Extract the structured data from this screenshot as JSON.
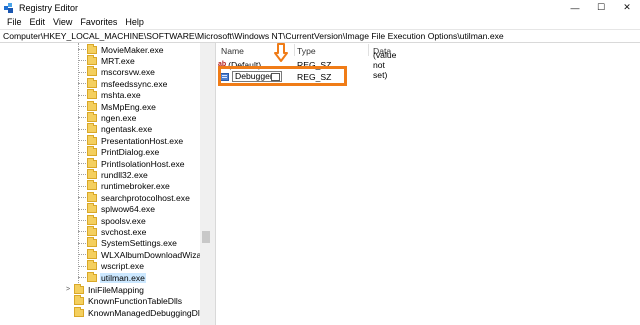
{
  "window": {
    "title": "Registry Editor",
    "controls": {
      "minimize": "—",
      "maximize": "☐",
      "close": "✕"
    },
    "icon": "regedit-icon"
  },
  "menu": [
    "File",
    "Edit",
    "View",
    "Favorites",
    "Help"
  ],
  "address": "Computer\\HKEY_LOCAL_MACHINE\\SOFTWARE\\Microsoft\\Windows NT\\CurrentVersion\\Image File Execution Options\\utilman.exe",
  "tree": {
    "items": [
      {
        "label": "MovieMaker.exe"
      },
      {
        "label": "MRT.exe"
      },
      {
        "label": "mscorsvw.exe"
      },
      {
        "label": "msfeedssync.exe"
      },
      {
        "label": "mshta.exe"
      },
      {
        "label": "MsMpEng.exe"
      },
      {
        "label": "ngen.exe"
      },
      {
        "label": "ngentask.exe"
      },
      {
        "label": "PresentationHost.exe"
      },
      {
        "label": "PrintDialog.exe"
      },
      {
        "label": "PrintIsolationHost.exe"
      },
      {
        "label": "rundll32.exe"
      },
      {
        "label": "runtimebroker.exe"
      },
      {
        "label": "searchprotocolhost.exe"
      },
      {
        "label": "splwow64.exe"
      },
      {
        "label": "spoolsv.exe"
      },
      {
        "label": "svchost.exe"
      },
      {
        "label": "SystemSettings.exe"
      },
      {
        "label": "WLXAlbumDownloadWizard.ex"
      },
      {
        "label": "wscript.exe"
      },
      {
        "label": "utilman.exe",
        "selected": true
      }
    ],
    "parent_items": [
      {
        "label": "IniFileMapping",
        "expander": ">"
      },
      {
        "label": "KnownFunctionTableDlls",
        "expander": ""
      },
      {
        "label": "KnownManagedDebuggingDlls",
        "expander": ""
      }
    ]
  },
  "values_pane": {
    "columns": [
      "Name",
      "Type",
      "Data"
    ],
    "rows": [
      {
        "name": "(Default)",
        "type": "REG_SZ",
        "data": "(value not set)",
        "icon": "string-value-icon"
      },
      {
        "name": "Debugger",
        "type": "REG_SZ",
        "data": "",
        "icon": "binary-value-icon",
        "editing": true
      }
    ]
  },
  "annotation": {
    "color": "#f07c17"
  }
}
